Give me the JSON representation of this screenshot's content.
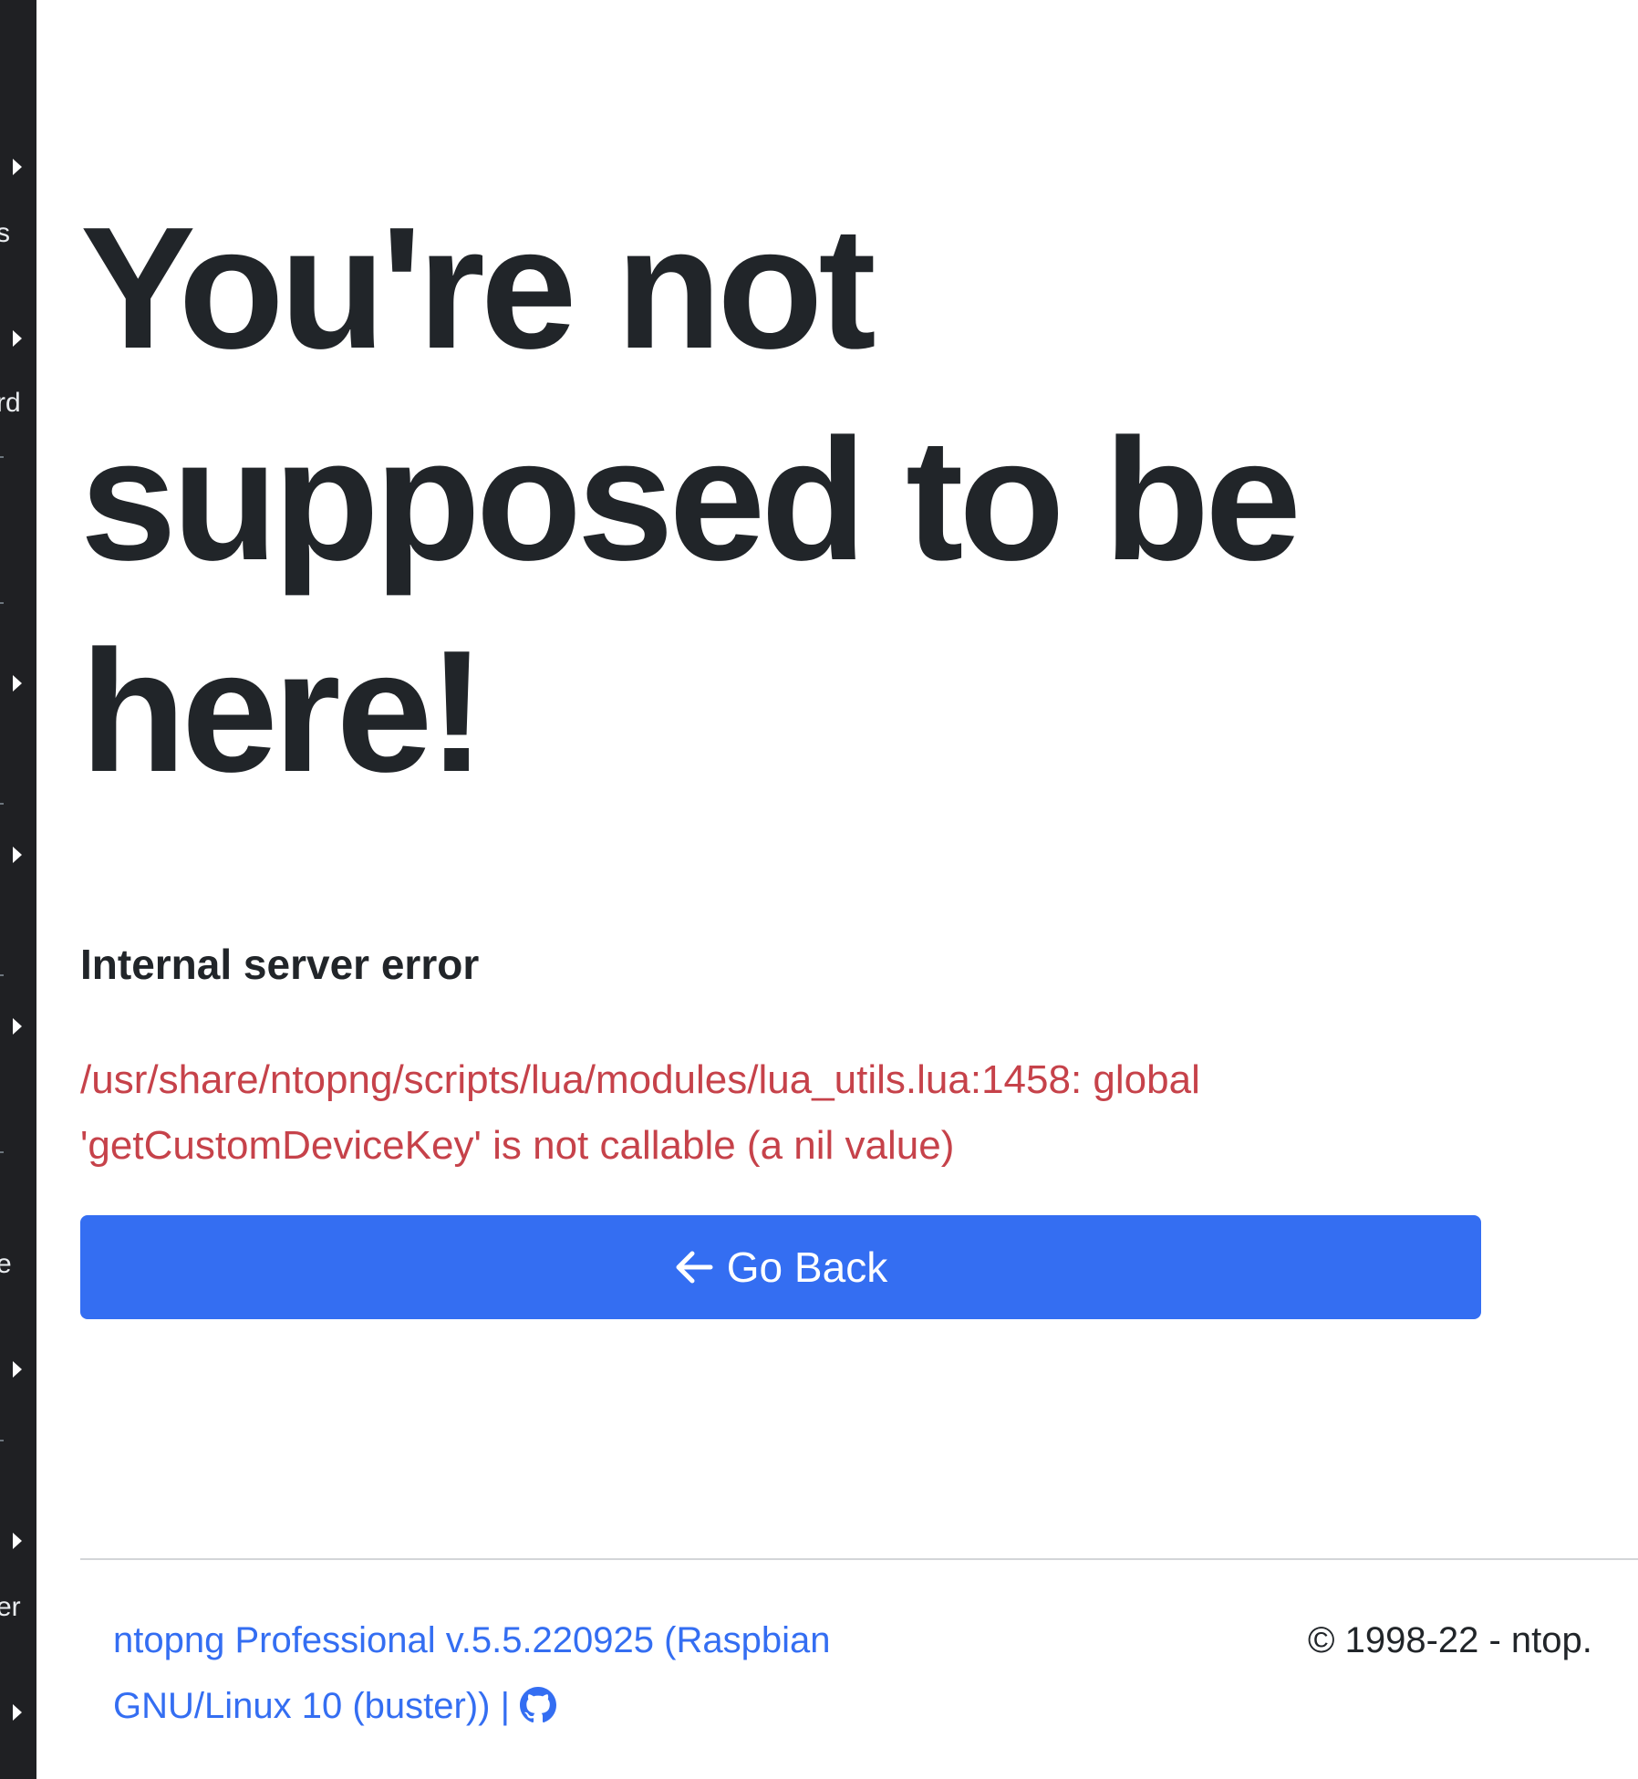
{
  "sidebar": {
    "fragments": [
      "s",
      "rd",
      "e",
      "er"
    ]
  },
  "page": {
    "title": "You're not supposed to be here!",
    "subtitle": "Internal server error",
    "error_message": "/usr/share/ntopng/scripts/lua/modules/lua_utils.lua:1458: global 'getCustomDeviceKey' is not callable (a nil value)",
    "back_button_label": "Go Back"
  },
  "footer": {
    "version": "ntopng Professional v.5.5.220925 (Raspbian GNU/Linux 10 (buster))",
    "separator": "|",
    "copyright": "© 1998-22 - ntop."
  },
  "colors": {
    "sidebar_bg": "#1f2023",
    "error_text": "#c6424a",
    "primary": "#346ef2",
    "link": "#346ef2"
  }
}
